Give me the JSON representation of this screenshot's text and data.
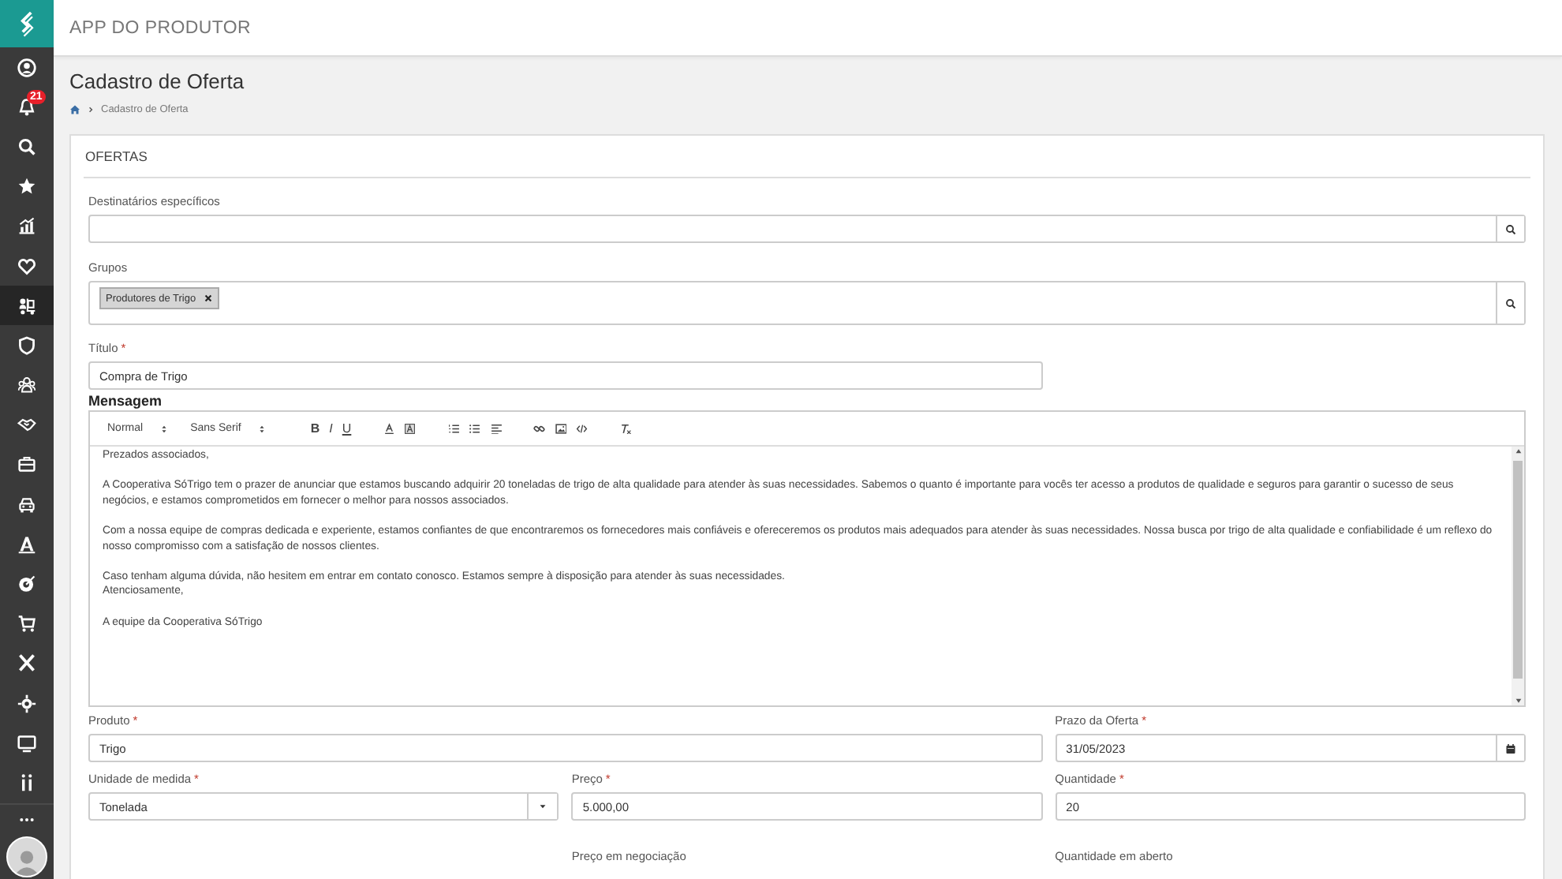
{
  "sidebar": {
    "items": [
      {
        "kind": "user",
        "selected": false
      },
      {
        "kind": "bell",
        "selected": false,
        "badge": "21"
      },
      {
        "kind": "search",
        "selected": false
      },
      {
        "kind": "star",
        "selected": false
      },
      {
        "kind": "chart",
        "selected": false
      },
      {
        "kind": "heart",
        "selected": false
      },
      {
        "kind": "dolly",
        "selected": true
      },
      {
        "kind": "shield",
        "selected": false
      },
      {
        "kind": "group",
        "selected": false
      },
      {
        "kind": "handshake",
        "selected": false
      },
      {
        "kind": "briefcase",
        "selected": false
      },
      {
        "kind": "car",
        "selected": false
      },
      {
        "kind": "triangle",
        "selected": false
      },
      {
        "kind": "target",
        "selected": false
      },
      {
        "kind": "cart",
        "selected": false
      },
      {
        "kind": "cross",
        "selected": false
      },
      {
        "kind": "crosshair",
        "selected": false
      },
      {
        "kind": "monitor",
        "selected": false
      },
      {
        "kind": "bars",
        "selected": false
      }
    ]
  },
  "header": {
    "title": "APP DO PRODUTOR"
  },
  "page": {
    "title": "Cadastro de Oferta",
    "breadcrumb": [
      "Cadastro de Oferta"
    ]
  },
  "card": {
    "title": "OFERTAS",
    "recipients": {
      "label": "Destinatários específicos"
    },
    "groups": {
      "label": "Grupos",
      "tags": [
        "Produtores de Trigo"
      ]
    },
    "title_field": {
      "label": "Título",
      "required_mark": "*",
      "value": "Compra de Trigo"
    },
    "message": {
      "label": "Mensagem",
      "toolbar": [
        {
          "kind": "picker",
          "label": "Normal"
        },
        {
          "kind": "picker",
          "label": "Sans Serif"
        },
        {
          "kind": "bold",
          "label": "B"
        },
        {
          "kind": "italic",
          "label": "I"
        },
        {
          "kind": "underline",
          "label": "U"
        },
        {
          "kind": "color"
        },
        {
          "kind": "background"
        },
        {
          "kind": "ordered-list"
        },
        {
          "kind": "bullet-list"
        },
        {
          "kind": "align"
        },
        {
          "kind": "link"
        },
        {
          "kind": "image"
        },
        {
          "kind": "code"
        },
        {
          "kind": "clean"
        }
      ],
      "paragraphs": [
        {
          "lines": [
            "Prezados associados,"
          ]
        },
        {
          "lines": [
            "A Cooperativa SóTrigo  tem o prazer de anunciar que estamos buscando adquirir 20 toneladas de trigo de alta qualidade para atender às suas necessidades. Sabemos o quanto é importante para vocês ter acesso a produtos de qualidade e seguros para garantir o sucesso de seus negócios, e estamos comprometidos em fornecer o melhor para nossos associados."
          ]
        },
        {
          "lines": [
            "Com a nossa equipe de compras dedicada e experiente, estamos confiantes de que encontraremos os fornecedores mais confiáveis e ofereceremos os produtos mais adequados para atender às suas necessidades. Nossa busca por trigo de alta qualidade e confiabilidade é um reflexo do nosso compromisso com a satisfação de nossos clientes."
          ]
        },
        {
          "lines": [
            "Caso tenham alguma dúvida, não hesitem em entrar em contato conosco. Estamos sempre à disposição para atender às suas necessidades.",
            "Atenciosamente,"
          ]
        },
        {
          "lines": [
            "A equipe da Cooperativa SóTrigo"
          ]
        }
      ]
    },
    "rows": [
      [
        {
          "kind": "text",
          "label": "Produto",
          "required_mark": "*",
          "value": "Trigo"
        },
        {
          "kind": "date",
          "label": "Prazo da Oferta",
          "required_mark": "*",
          "value": "31/05/2023"
        }
      ],
      [
        {
          "kind": "select",
          "label": "Unidade de medida",
          "required_mark": "*",
          "value": "Tonelada"
        },
        {
          "kind": "text",
          "label": "Preço",
          "required_mark": "*",
          "value": "5.000,00"
        },
        {
          "kind": "text",
          "label": "Quantidade",
          "required_mark": "*",
          "value": "20"
        }
      ],
      [
        {
          "kind": "caption",
          "label": "Preço em negociação"
        },
        {
          "kind": "caption",
          "label": "Quantidade em aberto"
        }
      ]
    ]
  }
}
